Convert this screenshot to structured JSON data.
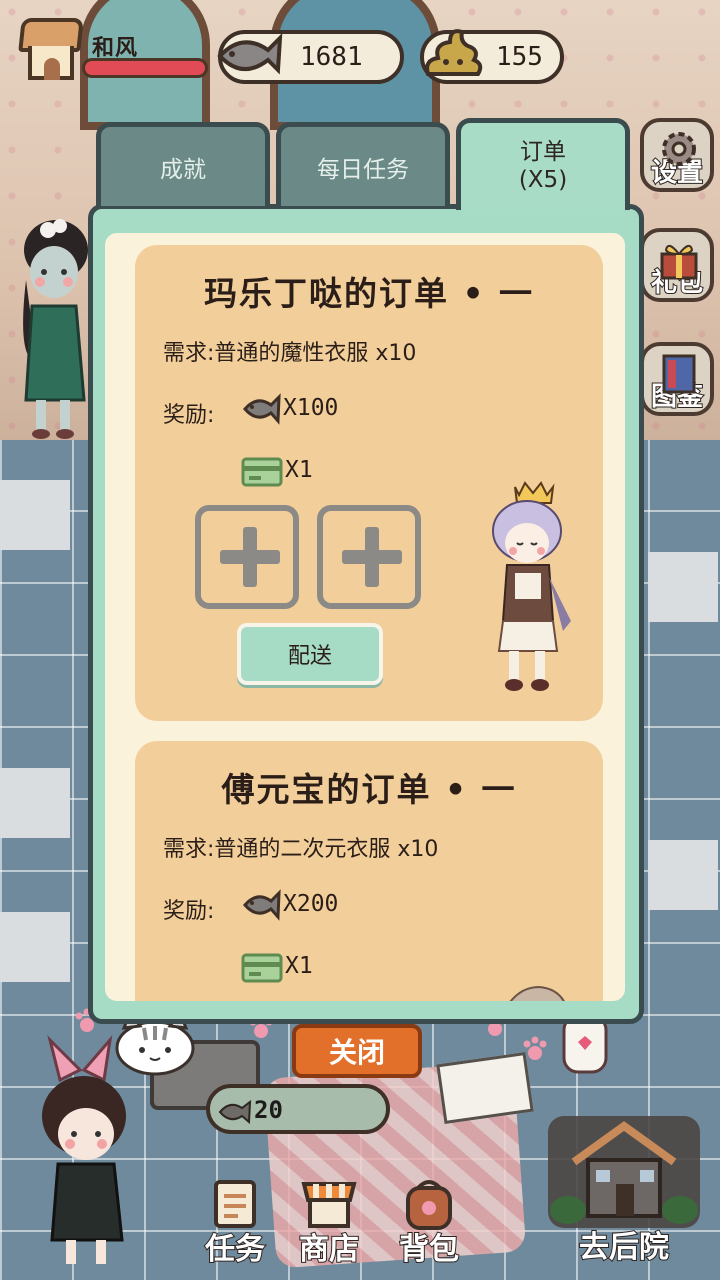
{
  "hud": {
    "player_name": "和风",
    "health_fraction": 1.0,
    "fish_count": "1681",
    "poop_count": "155"
  },
  "side_buttons": {
    "settings": "设置",
    "gift": "礼包",
    "catalog": "图鉴"
  },
  "tabs": [
    {
      "label": "成就",
      "active": false
    },
    {
      "label": "每日任务",
      "active": false
    },
    {
      "label": "订单\n(X5)",
      "active": true
    }
  ],
  "orders": [
    {
      "title": "玛乐丁哒的订单 • 一",
      "requirement": "需求:普通的魔性衣服 x10",
      "reward_label": "奖励:",
      "reward_fish": "X100",
      "reward_ticket": "X1",
      "deliver_label": "配送"
    },
    {
      "title": "傅元宝的订单 • 一",
      "requirement": "需求:普通的二次元衣服 x10",
      "reward_label": "奖励:",
      "reward_fish": "X200",
      "reward_ticket": "X1"
    }
  ],
  "close_label": "关闭",
  "fish_counter": "20",
  "bottom_nav": {
    "tasks": "任务",
    "shop": "商店",
    "bag": "背包",
    "backyard": "去后院"
  },
  "colors": {
    "panel": "#a6dcc6",
    "card": "#f2cf9a",
    "close_button": "#e2702b",
    "health": "#e04b56"
  }
}
